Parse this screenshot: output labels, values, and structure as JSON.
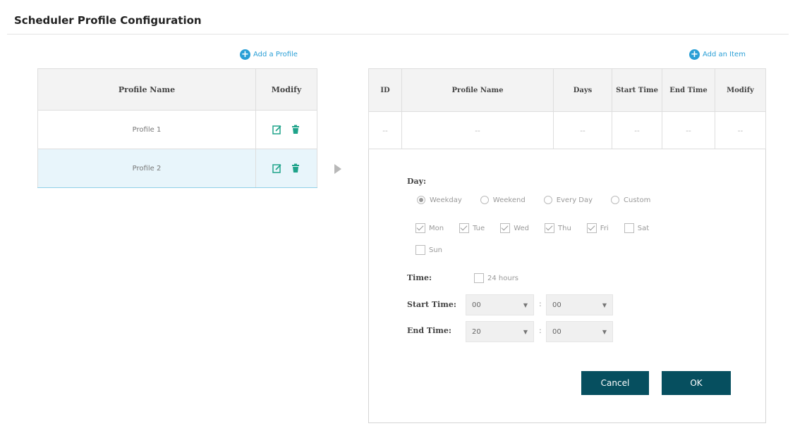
{
  "page": {
    "title": "Scheduler Profile Configuration"
  },
  "profiles": {
    "add_label": "Add a Profile",
    "headers": [
      "Profile Name",
      "Modify"
    ],
    "rows": [
      {
        "name": "Profile 1"
      },
      {
        "name": "Profile 2"
      }
    ]
  },
  "entries": {
    "add_label": "Add an Item",
    "headers": [
      "ID",
      "Profile Name",
      "Days",
      "Start Time",
      "End Time",
      "Modify"
    ],
    "row": [
      "--",
      "--",
      "--",
      "--",
      "--",
      "--"
    ]
  },
  "form": {
    "day_label": "Day:",
    "day_options": [
      "Weekday",
      "Weekend",
      "Every Day",
      "Custom"
    ],
    "selected_day": "Weekday",
    "weekdays": [
      {
        "label": "Mon",
        "checked": true
      },
      {
        "label": "Tue",
        "checked": true
      },
      {
        "label": "Wed",
        "checked": true
      },
      {
        "label": "Thu",
        "checked": true
      },
      {
        "label": "Fri",
        "checked": true
      },
      {
        "label": "Sat",
        "checked": false
      },
      {
        "label": "Sun",
        "checked": false
      }
    ],
    "time_label": "Time:",
    "hours24_label": "24 hours",
    "start_label": "Start Time:",
    "start_hour": "00",
    "start_minute": "00",
    "end_label": "End Time:",
    "end_hour": "20",
    "end_minute": "00",
    "separator": ":",
    "cancel_label": "Cancel",
    "ok_label": "OK"
  },
  "colors": {
    "accent": "#2a9fd6",
    "button": "#064f5f",
    "icon": "#1fa38a"
  }
}
